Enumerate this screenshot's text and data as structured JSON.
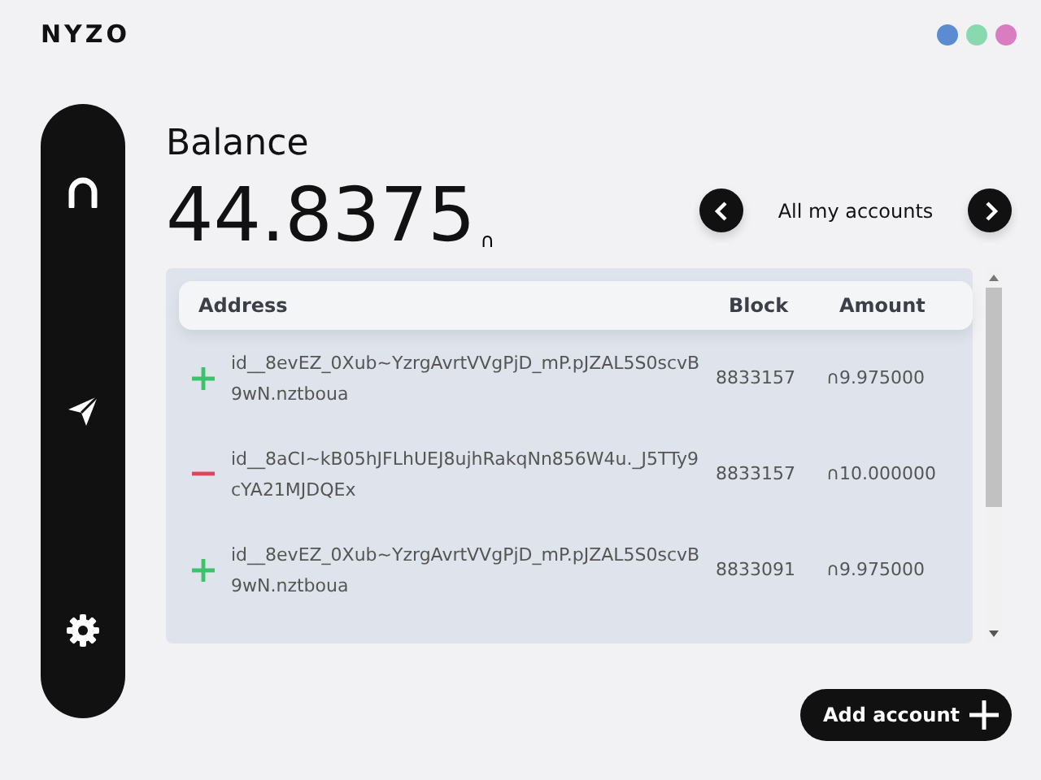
{
  "logo": "NYZO",
  "balance": {
    "title": "Balance",
    "amount": "44.8375",
    "unit": "∩"
  },
  "account_switcher": {
    "label": "All my accounts"
  },
  "table": {
    "columns": [
      "Address",
      "Block",
      "Amount"
    ],
    "rows": [
      {
        "kind": "incoming",
        "address": "id__8evEZ_0Xub~YzrgAvrtVVgPjD_mP.pJZAL5S0scvB9wN.nztboua",
        "block": "8833157",
        "amount": "∩9.975000"
      },
      {
        "kind": "outgoing",
        "address": "id__8aCI~kB05hJFLhUEJ8ujhRakqNn856W4u._J5TTy9cYA21MJDQEx",
        "block": "8833157",
        "amount": "∩10.000000"
      },
      {
        "kind": "incoming",
        "address": "id__8evEZ_0Xub~YzrgAvrtVVgPjD_mP.pJZAL5S0scvB9wN.nztboua",
        "block": "8833091",
        "amount": "∩9.975000"
      }
    ]
  },
  "add_button": {
    "label": "Add account"
  }
}
